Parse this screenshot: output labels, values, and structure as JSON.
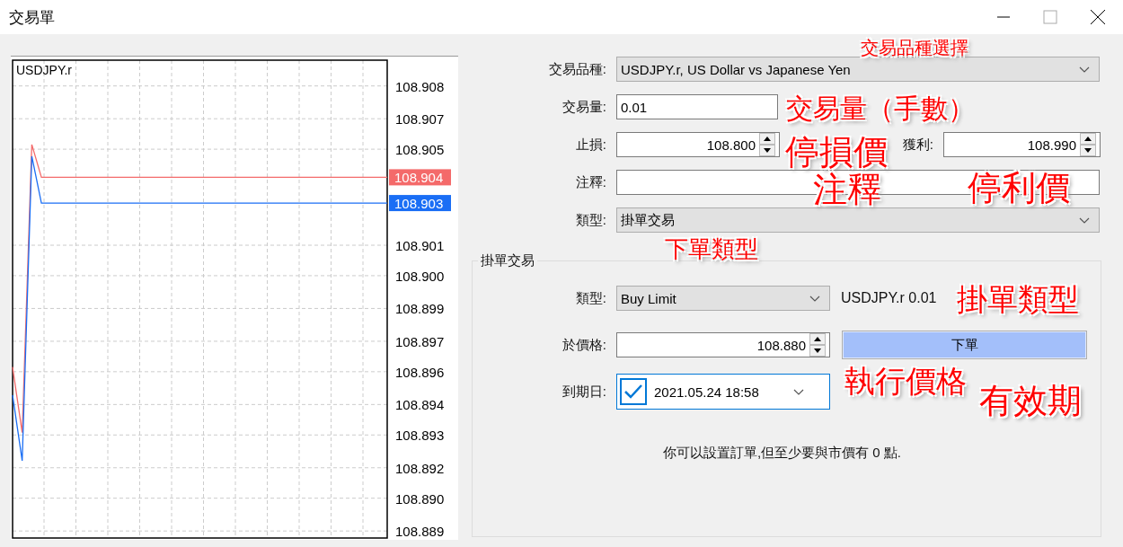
{
  "window": {
    "title": "交易單"
  },
  "chart": {
    "symbol": "USDJPY.r",
    "ask_tag": "108.904",
    "bid_tag": "108.903",
    "chart_data": {
      "type": "line",
      "grid": true,
      "categories": [
        null,
        null,
        null,
        null,
        null,
        null,
        null,
        null,
        null,
        null,
        null,
        null,
        null,
        null,
        null,
        null,
        null,
        null,
        null,
        null,
        null,
        null,
        null,
        null,
        null,
        null,
        null,
        null,
        null,
        null,
        null,
        null,
        null,
        null,
        null,
        null,
        null,
        null,
        null,
        null
      ],
      "ylim": [
        108.8887,
        108.9091
      ],
      "yticks": [
        {
          "value": 108.908,
          "label": "108.908"
        },
        {
          "value": 108.9066,
          "label": "108.907"
        },
        {
          "value": 108.9053,
          "label": "108.905"
        },
        {
          "value": 108.9012,
          "label": "108.901"
        },
        {
          "value": 108.8999,
          "label": "108.900"
        },
        {
          "value": 108.8985,
          "label": "108.899"
        },
        {
          "value": 108.8971,
          "label": "108.897"
        },
        {
          "value": 108.8958,
          "label": "108.896"
        },
        {
          "value": 108.8944,
          "label": "108.894"
        },
        {
          "value": 108.8931,
          "label": "108.893"
        },
        {
          "value": 108.8917,
          "label": "108.892"
        },
        {
          "value": 108.8904,
          "label": "108.890"
        },
        {
          "value": 108.889,
          "label": "108.889"
        }
      ],
      "series": [
        {
          "color": "#f46a6a",
          "values": [
            108.896,
            108.8932,
            108.9055,
            108.9041,
            108.9041,
            108.9041,
            108.9041,
            108.9041,
            108.9041,
            108.9041,
            108.9041,
            108.9041,
            108.9041,
            108.9041,
            108.9041,
            108.9041,
            108.9041,
            108.9041,
            108.9041,
            108.9041,
            108.9041,
            108.9041,
            108.9041,
            108.9041,
            108.9041,
            108.9041,
            108.9041,
            108.9041,
            108.9041,
            108.9041,
            108.9041,
            108.9041,
            108.9041,
            108.9041,
            108.9041,
            108.9041,
            108.9041,
            108.9041,
            108.9041,
            108.9041
          ]
        },
        {
          "color": "#1a6ef5",
          "values": [
            108.8948,
            108.892,
            108.905,
            108.903,
            108.903,
            108.903,
            108.903,
            108.903,
            108.903,
            108.903,
            108.903,
            108.903,
            108.903,
            108.903,
            108.903,
            108.903,
            108.903,
            108.903,
            108.903,
            108.903,
            108.903,
            108.903,
            108.903,
            108.903,
            108.903,
            108.903,
            108.903,
            108.903,
            108.903,
            108.903,
            108.903,
            108.903,
            108.903,
            108.903,
            108.903,
            108.903,
            108.903,
            108.903,
            108.903,
            108.903
          ]
        }
      ]
    }
  },
  "order": {
    "symbol_label": "交易品種:",
    "symbol_value": "USDJPY.r, US Dollar vs Japanese Yen",
    "volume_label": "交易量:",
    "volume_value": "0.01",
    "stop_loss_label": "止損:",
    "stop_loss_value": "108.800",
    "take_profit_label": "獲利:",
    "take_profit_value": "108.990",
    "comment_label": "注釋:",
    "type_label": "類型:",
    "type_value": "掛單交易"
  },
  "pending": {
    "legend": "掛單交易",
    "type_label": "類型:",
    "type_value": "Buy Limit",
    "summary": "USDJPY.r 0.01",
    "price_label": "於價格:",
    "price_value": "108.880",
    "place_button": "下單",
    "expiry_label": "到期日:",
    "expiry_enabled": true,
    "expiry_value": "2021.05.24 18:58",
    "note": "你可以設置訂單,但至少要與市價有 0 點."
  },
  "annotations": [
    {
      "text": "交易品種選擇"
    },
    {
      "text": "交易量（手數）"
    },
    {
      "text": "停損價"
    },
    {
      "text": "停利價"
    },
    {
      "text": "注釋"
    },
    {
      "text": "下單類型"
    },
    {
      "text": "掛單類型"
    },
    {
      "text": "執行價格"
    },
    {
      "text": "有效期"
    }
  ]
}
